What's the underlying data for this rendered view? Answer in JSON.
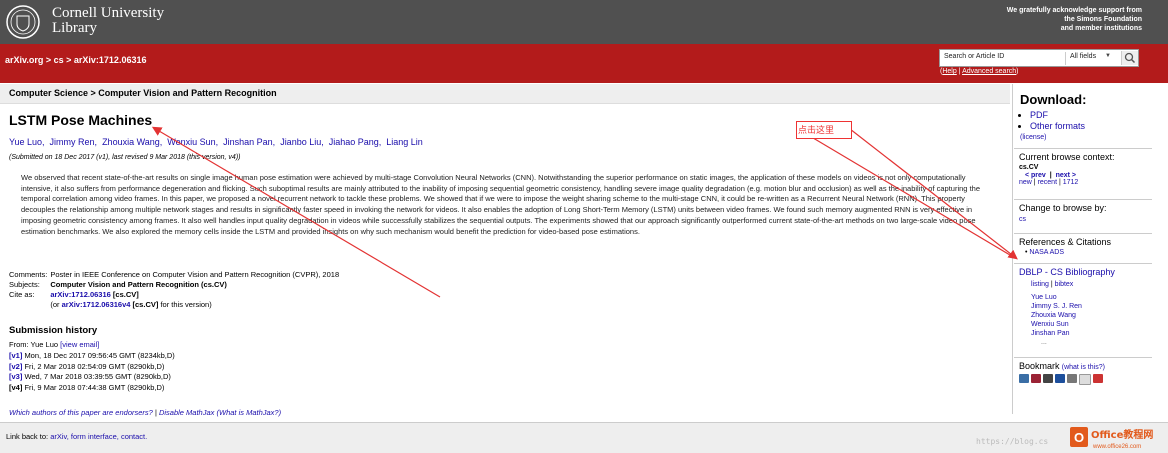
{
  "header": {
    "library_name_line1": "Cornell University",
    "library_name_line2": "Library",
    "support_line1": "We gratefully acknowledge support from",
    "support_line2": "the Simons Foundation",
    "support_line3": "and member institutions"
  },
  "breadcrumb": {
    "site": "arXiv.org",
    "sep1": " > ",
    "category": "cs",
    "sep2": " > ",
    "paper": "arXiv:1712.06316"
  },
  "search": {
    "placeholder": "Search or Article ID",
    "field_select": "All fields",
    "help": "Help",
    "separator": " | ",
    "advanced": "Advanced search",
    "open_paren": "(",
    "close_paren": ")"
  },
  "subject_heading": "Computer Science > Computer Vision and Pattern Recognition",
  "paper": {
    "title": "LSTM Pose Machines",
    "authors": [
      "Yue Luo,",
      "Jimmy Ren,",
      "Zhouxia Wang,",
      "Wenxiu Sun,",
      "Jinshan Pan,",
      "Jianbo Liu,",
      "Jiahao Pang,",
      "Liang Lin"
    ],
    "submitted": "(Submitted on 18 Dec 2017 (v1), last revised 9 Mar 2018 (this version, v4))",
    "abstract": "We observed that recent state-of-the-art results on single image human pose estimation were achieved by multi-stage Convolution Neural Networks (CNN). Notwithstanding the superior performance on static images, the application of these models on videos is not only computationally intensive, it also suffers from performance degeneration and flicking. Such suboptimal results are mainly attributed to the inability of imposing sequential geometric consistency, handling severe image quality degradation (e.g. motion blur and occlusion) as well as the inability of capturing the temporal correlation among video frames. In this paper, we proposed a novel recurrent network to tackle these problems. We showed that if we were to impose the weight sharing scheme to the multi-stage CNN, it could be re-written as a Recurrent Neural Network (RNN). This property decouples the relationship among multiple network stages and results in significantly faster speed in invoking the network for videos. It also enables the adoption of Long Short-Term Memory (LSTM) units between video frames. We found such memory augmented RNN is very effective in imposing geometric consistency among frames. It also well handles input quality degradation in videos while successfully stabilizes the sequential outputs. The experiments showed that our approach significantly outperformed current state-of-the-art methods on two large-scale video pose estimation benchmarks. We also explored the memory cells inside the LSTM and provided insights on why such mechanism would benefit the prediction for video-based pose estimations.",
    "comments_label": "Comments:",
    "comments": "Poster in IEEE Conference on Computer Vision and Pattern Recognition (CVPR), 2018",
    "subjects_label": "Subjects:",
    "subjects": "Computer Vision and Pattern Recognition (cs.CV)",
    "cite_label": "Cite as:",
    "cite_id": "arXiv:1712.06316",
    "cite_cat": "[cs.CV]",
    "cite_or": "(or",
    "cite_v4": "arXiv:1712.06316v4",
    "cite_v4_cat": "[cs.CV]",
    "cite_tail": "for this version)"
  },
  "history": {
    "heading": "Submission history",
    "from_label": "From: Yue Luo",
    "view_email": "[view email]",
    "versions": [
      {
        "tag": "[v1]",
        "text": "Mon, 18 Dec 2017 09:56:45 GMT (8234kb,D)"
      },
      {
        "tag": "[v2]",
        "text": "Fri, 2 Mar 2018 02:54:09 GMT (8290kb,D)"
      },
      {
        "tag": "[v3]",
        "text": "Wed, 7 Mar 2018 03:39:55 GMT (8290kb,D)"
      },
      {
        "tag": "[v4]",
        "text": "Fri, 9 Mar 2018 07:44:38 GMT (8290kb,D)"
      }
    ]
  },
  "endorse": {
    "link1": "Which authors of this paper are endorsers?",
    "sep": " | ",
    "link2": "Disable MathJax",
    "link3": "(What is MathJax?)"
  },
  "footer": {
    "prefix": "Link back to:",
    "arxiv": "arXiv,",
    "form": "form interface,",
    "contact": "contact."
  },
  "sidebar": {
    "download_heading": "Download:",
    "pdf": "PDF",
    "other_formats": "Other formats",
    "license": "(license)",
    "browse_context_heading": "Current browse context:",
    "browse_context": "cs.CV",
    "prev": "< prev",
    "next": "next >",
    "new": "new",
    "recent": "recent",
    "period": "1712",
    "change_browse_heading": "Change to browse by:",
    "change_cs": "cs",
    "refs_heading": "References & Citations",
    "nasa": "NASA ADS",
    "dblp_heading": "DBLP - CS Bibliography",
    "listing": "listing",
    "bibtex": "bibtex",
    "dblp_authors": [
      "Yue Luo",
      "Jimmy S. J. Ren",
      "Zhouxia Wang",
      "Wenxiu Sun",
      "Jinshan Pan"
    ],
    "ellipsis": "...",
    "bookmark_heading": "Bookmark",
    "what_is_this": "(what is this?)"
  },
  "annotation": {
    "text": "点击这里",
    "color": "#e33333"
  },
  "watermark": {
    "url_text": "https://blog.cs",
    "brand": "Office教程网",
    "brand_url": "www.office26.com"
  },
  "colors": {
    "red_band": "#b31b1b",
    "header_gray": "#505050",
    "link": "#1a0dab"
  }
}
